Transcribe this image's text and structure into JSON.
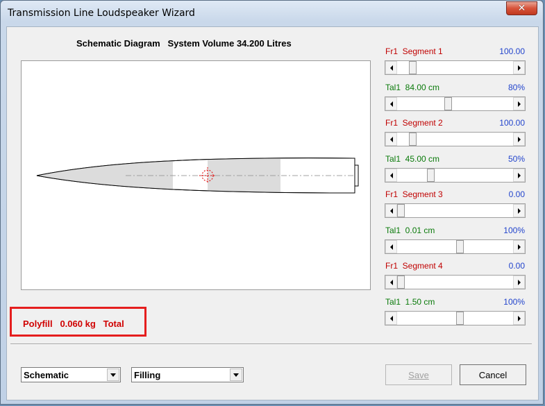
{
  "window": {
    "title": "Transmission Line Loudspeaker Wizard",
    "close_icon": "close-icon"
  },
  "diagram": {
    "title": "Schematic Diagram   System Volume 34.200 Litres"
  },
  "polyfill": {
    "text": "Polyfill   0.060 kg   Total"
  },
  "sliders": [
    {
      "label": "Fr1  Segment 1",
      "value": "100.00",
      "label_color": "red",
      "value_color": "blue",
      "position": 0.11
    },
    {
      "label": "Tal1  84.00 cm",
      "value": "80%",
      "label_color": "green",
      "value_color": "blue",
      "position": 0.43
    },
    {
      "label": "Fr1  Segment 2",
      "value": "100.00",
      "label_color": "red",
      "value_color": "blue",
      "position": 0.11
    },
    {
      "label": "Tal1  45.00 cm",
      "value": "50%",
      "label_color": "green",
      "value_color": "blue",
      "position": 0.27
    },
    {
      "label": "Fr1  Segment 3",
      "value": "0.00",
      "label_color": "red",
      "value_color": "blue",
      "position": 0.0
    },
    {
      "label": "Tal1  0.01 cm",
      "value": "100%",
      "label_color": "green",
      "value_color": "blue",
      "position": 0.54
    },
    {
      "label": "Fr1  Segment 4",
      "value": "0.00",
      "label_color": "red",
      "value_color": "blue",
      "position": 0.0
    },
    {
      "label": "Tal1  1.50 cm",
      "value": "100%",
      "label_color": "green",
      "value_color": "blue",
      "position": 0.54
    }
  ],
  "footer": {
    "view_select": "Schematic",
    "mode_select": "Filling",
    "save_label": "Save",
    "cancel_label": "Cancel"
  }
}
